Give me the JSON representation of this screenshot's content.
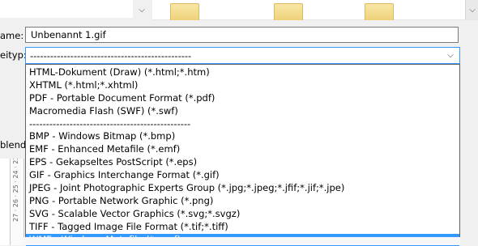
{
  "form": {
    "name_label": "ame:",
    "type_label": "eityp:",
    "hidden_label": "blende",
    "filename_value": "Unbenannt 1.gif",
    "selected_type": "------------------------------------------------"
  },
  "dropdown": {
    "options": [
      "HTML-Dokument (Draw) (*.html;*.htm)",
      "XHTML (*.html;*.xhtml)",
      "PDF - Portable Document Format (*.pdf)",
      "Macromedia Flash (SWF) (*.swf)",
      "------------------------------------------------",
      "BMP - Windows Bitmap (*.bmp)",
      "EMF - Enhanced Metafile (*.emf)",
      "EPS - Gekapseltes PostScript (*.eps)",
      "GIF - Graphics Interchange Format (*.gif)",
      "JPEG - Joint Photographic Experts Group (*.jpg;*.jpeg;*.jfif;*.jif;*.jpe)",
      "PNG - Portable Network Graphic (*.png)",
      "SVG - Scalable Vector Graphics (*.svg;*.svgz)",
      "TIFF - Tagged Image File Format (*.tif;*.tiff)",
      "WMF - Windows Metafile (*.wmf)"
    ],
    "selected_index": 13
  },
  "ruler": {
    "text": "27 · 26 · 25 · 24 · 23"
  },
  "icons": {
    "chevron_down": "⌄",
    "scroll_down": "⌄",
    "folder": "folder-icon"
  },
  "colors": {
    "selection": "#3399ff",
    "focus_border": "#3399ff",
    "folder": "#efd27a"
  }
}
